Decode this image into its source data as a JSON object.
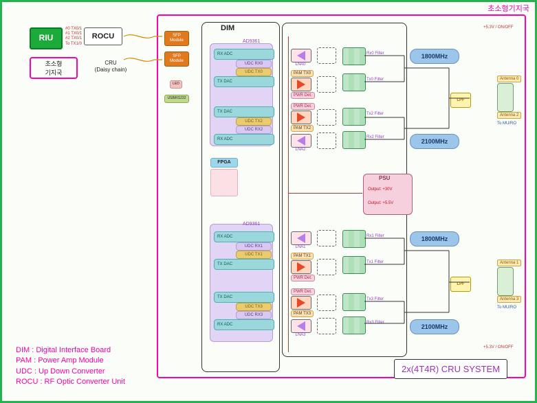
{
  "title_top": "초소형기지국",
  "riu": "RIU",
  "rocu": "ROCU",
  "small_bs_box": "초소형\n기지국",
  "cru_daisy": "CRU\n(Daisy chain)",
  "sfp": "SFP\nModule",
  "dim": "DIM",
  "fpga": "FPGA",
  "led": "LED",
  "usb": "USB/RS232",
  "ad9361": "AD9361",
  "rx_adc": "RX ADC",
  "tx_dac": "TX DAC",
  "udc_rx0": "UDC RX0",
  "udc_tx0": "UDC TX0",
  "udc_tx2": "UDC TX2",
  "udc_rx2": "UDC RX2",
  "udc_rx1": "UDC RX1",
  "udc_tx1": "UDC TX1",
  "udc_tx3": "UDC TX3",
  "udc_rx3": "UDC RX3",
  "lna0": "LNA0",
  "lna1": "LNA1",
  "lna2": "LNA2",
  "lna3": "LNA3",
  "pam_tx0": "PAM TX0",
  "pam_tx1": "PAM TX1",
  "pam_tx2": "PAM TX2",
  "pam_tx3": "PAM TX3",
  "pwr_det": "PWR Det.",
  "rx0_filter": "Rx0 Filter",
  "tx0_filter": "Tx0 Filter",
  "tx2_filter": "Tx2 Filter",
  "rx2_filter": "Rx2 Filter",
  "rx1_filter": "Rx1 Filter",
  "tx1_filter": "Tx1 Filter",
  "tx3_filter": "Tx3 Filter",
  "rx3_filter": "Rx3 Filter",
  "freq_1800": "1800MHz",
  "freq_2100": "2100MHz",
  "lpf": "LPF",
  "ant0": "Antenna 0",
  "ant1": "Antenna 1",
  "ant2": "Antenna 2",
  "ant3": "Antenna 3",
  "to_mu": "To MU/RO",
  "psu": "PSU",
  "psu_30v": "Output: +30V",
  "psu_5_5v": "Output: +5.5V",
  "pwr_5_3": "+5.3V / ON/OFF",
  "legend_dim": "DIM : Digital Interface Board",
  "legend_pam": "PAM : Power Amp Module",
  "legend_udc": "UDC : Up Down Converter",
  "legend_rocu": "ROCU : RF Optic Converter Unit",
  "sys_title": "2x(4T4R) CRU SYSTEM",
  "ant_lines": [
    "#0 TX0/1",
    "#1 TX0/1",
    "#2 TX0/1",
    "To TX1/0"
  ]
}
